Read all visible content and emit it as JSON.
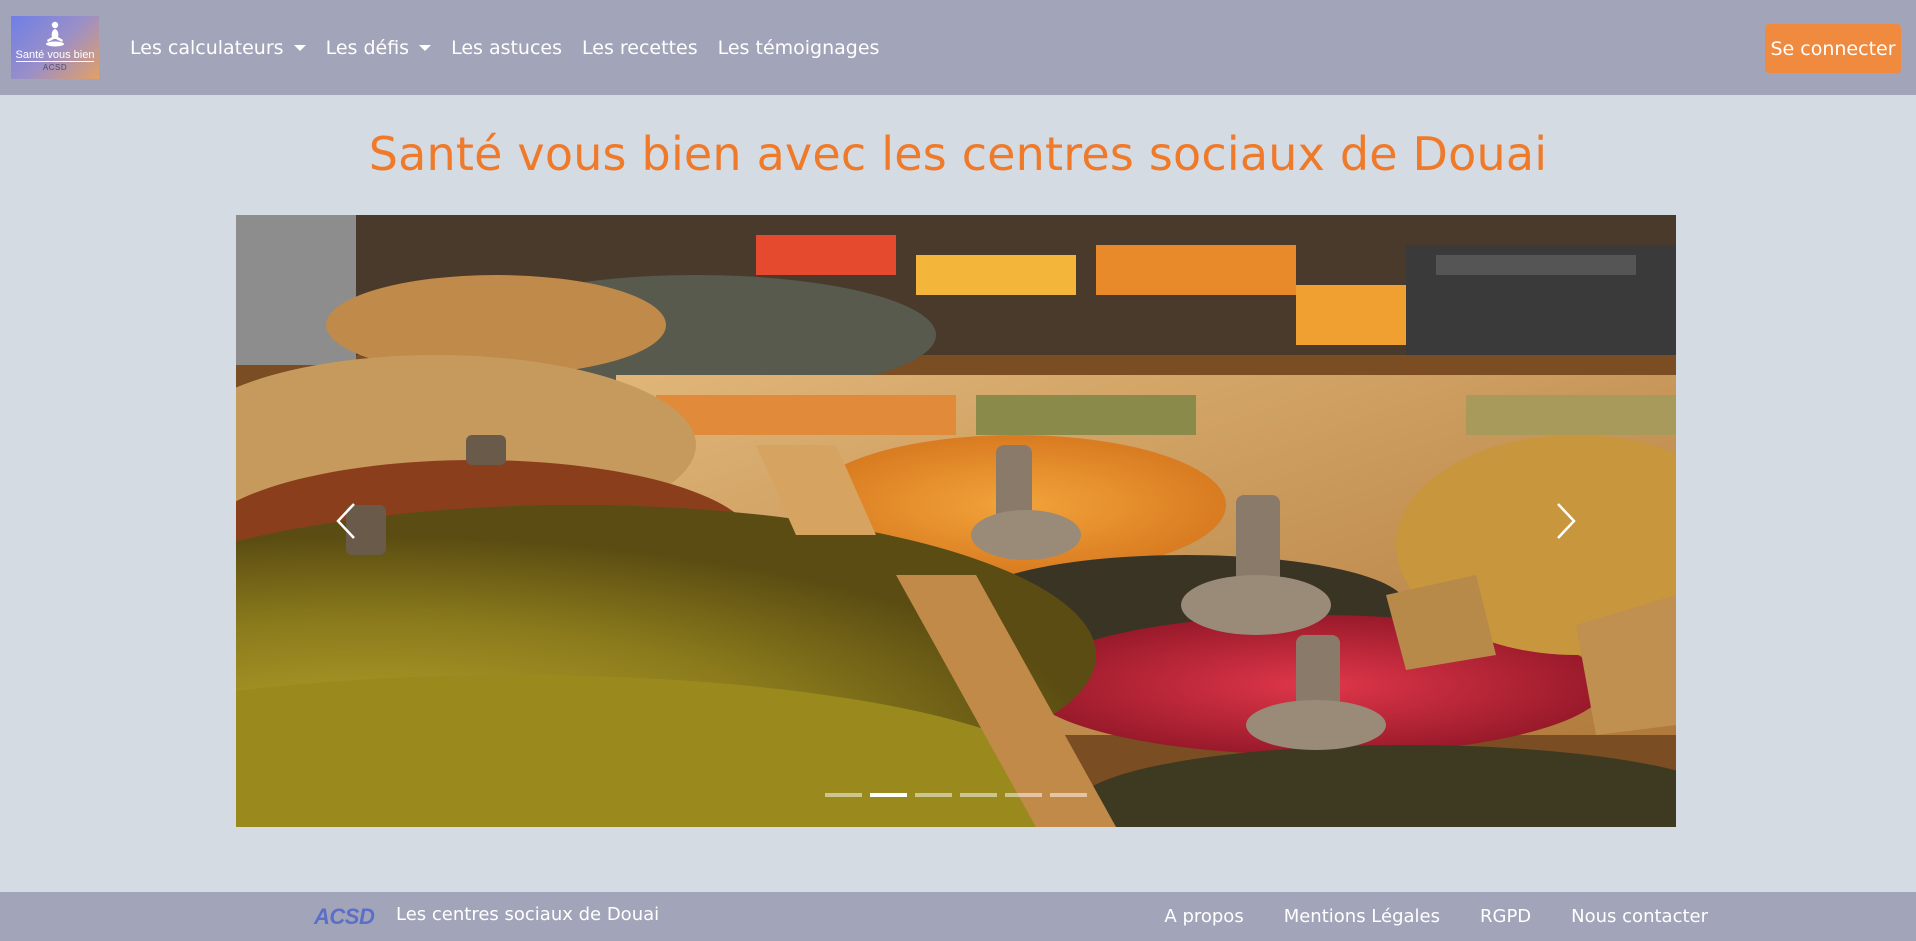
{
  "logo": {
    "title": "Santé vous bien",
    "subtitle": "ACSD"
  },
  "nav": {
    "items": [
      {
        "label": "Les calculateurs",
        "dropdown": true
      },
      {
        "label": "Les défis",
        "dropdown": true
      },
      {
        "label": "Les astuces",
        "dropdown": false
      },
      {
        "label": "Les recettes",
        "dropdown": false
      },
      {
        "label": "Les témoignages",
        "dropdown": false
      }
    ],
    "login_label": "Se connecter"
  },
  "main": {
    "title": "Santé vous bien avec les centres sociaux de Douai"
  },
  "carousel": {
    "slide_count": 6,
    "active_index": 1,
    "prev_icon": "chevron-left-icon",
    "next_icon": "chevron-right-icon"
  },
  "footer": {
    "logo_text": "ACSD",
    "brand": "Les centres sociaux de Douai",
    "links": [
      "A propos",
      "Mentions Légales",
      "RGPD",
      "Nous contacter"
    ]
  },
  "colors": {
    "navbar": "#a2a5b9",
    "background": "#d5dbe3",
    "accent": "#ee7a2a",
    "button": "#f08a3e"
  }
}
